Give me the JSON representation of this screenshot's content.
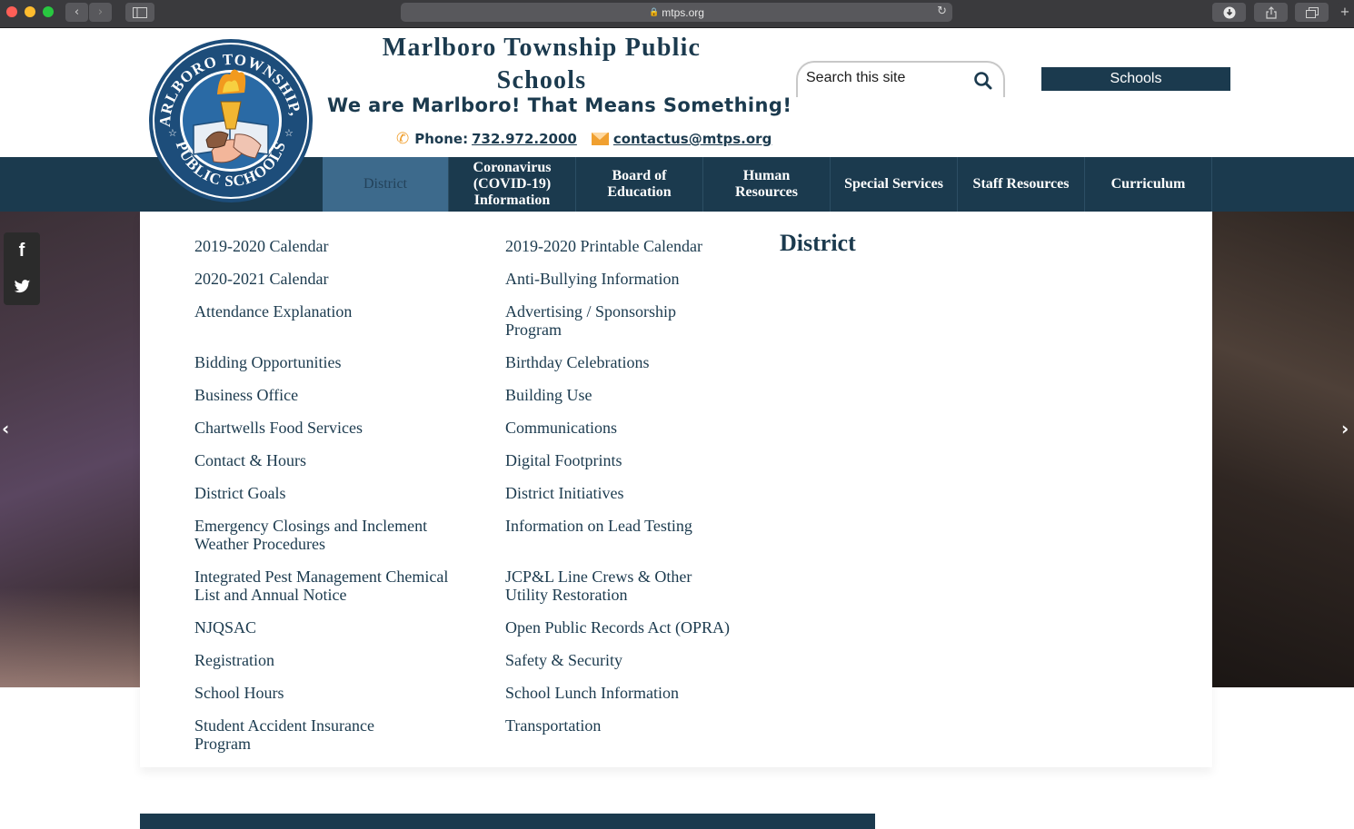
{
  "browser": {
    "url": "mtps.org"
  },
  "header": {
    "title": "Marlboro Township Public Schools",
    "tagline": "We are Marlboro! That Means Something!",
    "phone_label": "Phone:",
    "phone": "732.972.2000",
    "email": "contactus@mtps.org",
    "search_placeholder": "Search this site",
    "schools_button": "Schools",
    "logo_text_top": "MARLBORO TOWNSHIP, NJ",
    "logo_text_bottom": "PUBLIC SCHOOLS"
  },
  "nav": {
    "items": [
      {
        "label": "District",
        "active": true
      },
      {
        "label": "Coronavirus (COVID-19) Information"
      },
      {
        "label": "Board of Education"
      },
      {
        "label": "Human Resources"
      },
      {
        "label": "Special Services"
      },
      {
        "label": "Staff Resources"
      },
      {
        "label": "Curriculum"
      }
    ]
  },
  "social": {
    "items": [
      {
        "icon": "facebook-icon",
        "glyph": "f"
      },
      {
        "icon": "twitter-icon"
      }
    ]
  },
  "mega_menu": {
    "heading": "District",
    "col1": [
      "2019-2020 Calendar",
      "2020-2021 Calendar",
      "Attendance Explanation",
      "Bidding Opportunities",
      "Business Office",
      "Chartwells Food Services",
      "Contact & Hours",
      "District Goals",
      "Emergency Closings and Inclement Weather Procedures",
      "Integrated Pest Management Chemical List and Annual Notice",
      "NJQSAC",
      "Registration",
      "School Hours",
      "Student Accident Insurance Program"
    ],
    "col2": [
      "2019-2020 Printable Calendar",
      "Anti-Bullying Information",
      "Advertising / Sponsorship Program",
      "Birthday Celebrations",
      "Building Use",
      "Communications",
      "Digital Footprints",
      "District Initiatives",
      "Information on Lead Testing",
      "JCP&L Line Crews & Other Utility Restoration",
      "Open Public Records Act (OPRA)",
      "Safety & Security",
      "School Lunch Information",
      "Transportation"
    ]
  },
  "colors": {
    "navy": "#1b3a4e",
    "active_nav": "#3d6a8c",
    "accent_orange": "#f0a030"
  }
}
